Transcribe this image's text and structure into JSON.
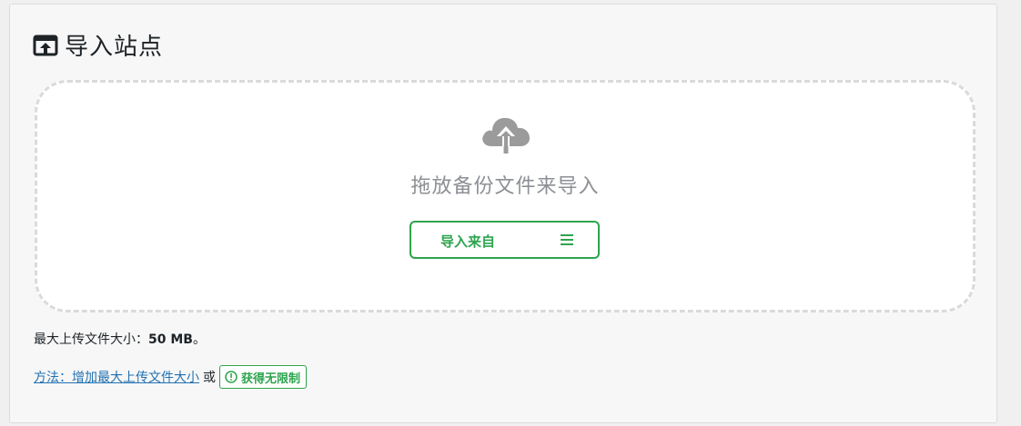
{
  "header": {
    "title": "导入站点",
    "icon": "import-site-icon"
  },
  "dropzone": {
    "icon": "cloud-upload-icon",
    "text": "拖放备份文件来导入",
    "import_button_label": "导入来自",
    "import_button_icon": "hamburger-menu-icon"
  },
  "upload_limit": {
    "label": "最大上传文件大小：",
    "value": "50 MB",
    "suffix": "。"
  },
  "help": {
    "method_link": "方法：增加最大上传文件大小",
    "or_text": "或",
    "unlimited_button": "获得无限制",
    "unlimited_icon": "exclamation-circle-icon"
  },
  "colors": {
    "accent": "#2da44e",
    "link": "#2271b1",
    "muted": "#8c8f94",
    "border_dashed": "#dadada"
  }
}
